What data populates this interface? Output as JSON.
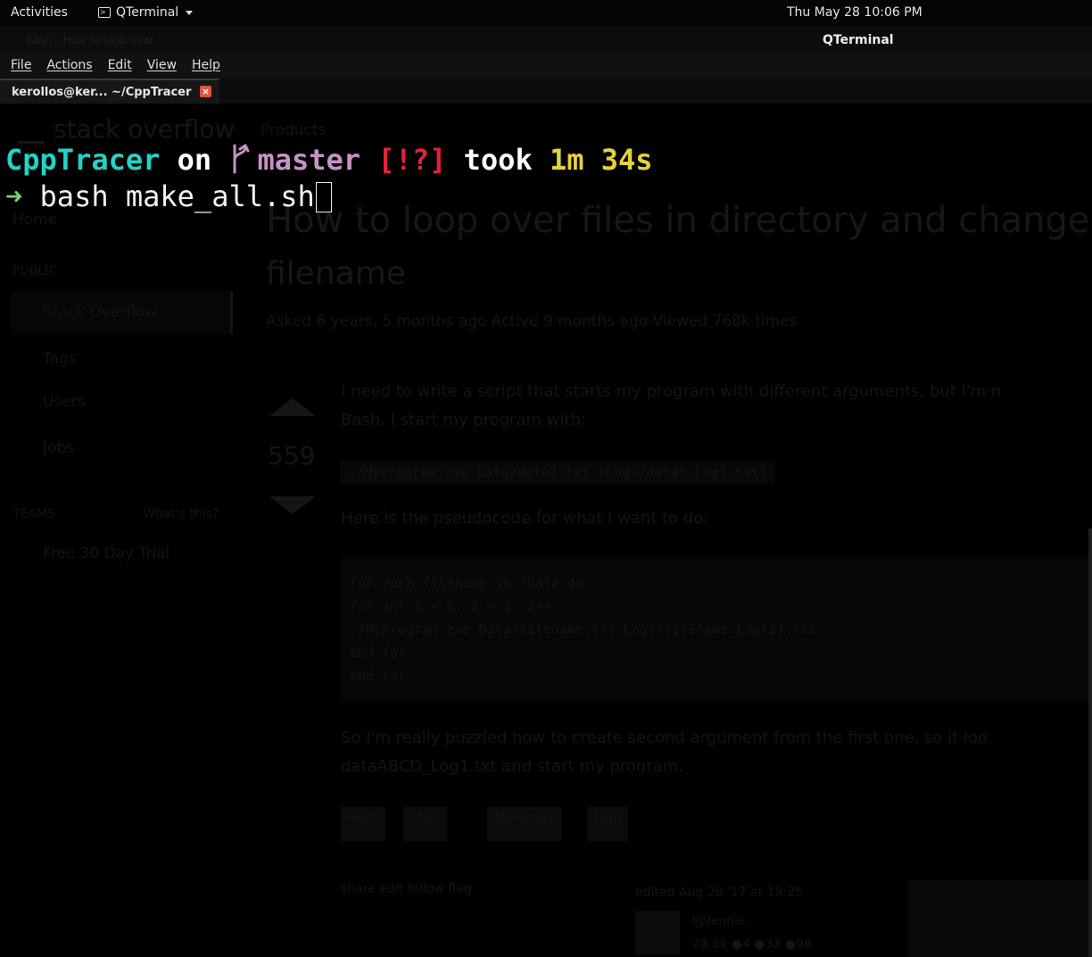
{
  "topbar": {
    "activities": "Activities",
    "app_name": "QTerminal",
    "clock": "Thu May 28  10:06 PM"
  },
  "window": {
    "title": "QTerminal"
  },
  "menu": {
    "items": [
      "File",
      "Actions",
      "Edit",
      "View",
      "Help"
    ]
  },
  "tab": {
    "label": "kerollos@ker... ~/CppTracer",
    "close_icon": "close-icon"
  },
  "prompt": {
    "directory": "CppTracer",
    "on": "on",
    "branch": "master",
    "status": "[!?]",
    "took": "took",
    "duration": "1m 34s",
    "arrow": "➜",
    "command": "bash make_all.sh"
  },
  "colors": {
    "directory": "#22d3c5",
    "branch": "#c792c7",
    "status": "#e8203a",
    "duration": "#e6d23a",
    "arrow": "#6fd36a"
  },
  "background_browser": {
    "tab_text": "bash - How to loop over",
    "logo": "stack overflow",
    "products": "Products",
    "question_title_1": "How to loop over files in directory and change pa",
    "question_title_2": "filename",
    "meta": "Asked 6 years, 5 months ago    Active 9 months ago    Viewed 768k times",
    "sidebar": [
      "Home",
      "PUBLIC",
      "Stack Overflow",
      "Tags",
      "Users",
      "Jobs",
      "TEAMS",
      "What's this?",
      "Free 30 Day Trial"
    ],
    "votes": "559",
    "body_1": "I need to write a script that starts my program with different arguments, but I'm n",
    "body_2": "Bash. I start my program with:",
    "code_inline": "./MyProgram.exe Data/data1.txt [Logs/data1_Log1.txt]",
    "body_3": "Here is the pseudocode for what I want to do:",
    "code_lines": [
      "for each filename in /Data do",
      "  for int i = 0, i = 3, i++",
      "    ./MyProgram.exe Data/filename.txt Logs/filename_Log{i}.txt",
      "  end for",
      "end for"
    ],
    "body_4": "So I'm really puzzled how to create second argument from the first one, so it loo",
    "body_5": "dataABCD_Log1.txt and start my program.",
    "tags": [
      "bash",
      "shell",
      "filenames",
      "loop"
    ],
    "share": "share  edit  follow  flag",
    "edited": "edited Aug 28 '17 at 19:25",
    "user": "Ijplennie",
    "rep": "28.5k  ●4  ●33  ●98"
  }
}
